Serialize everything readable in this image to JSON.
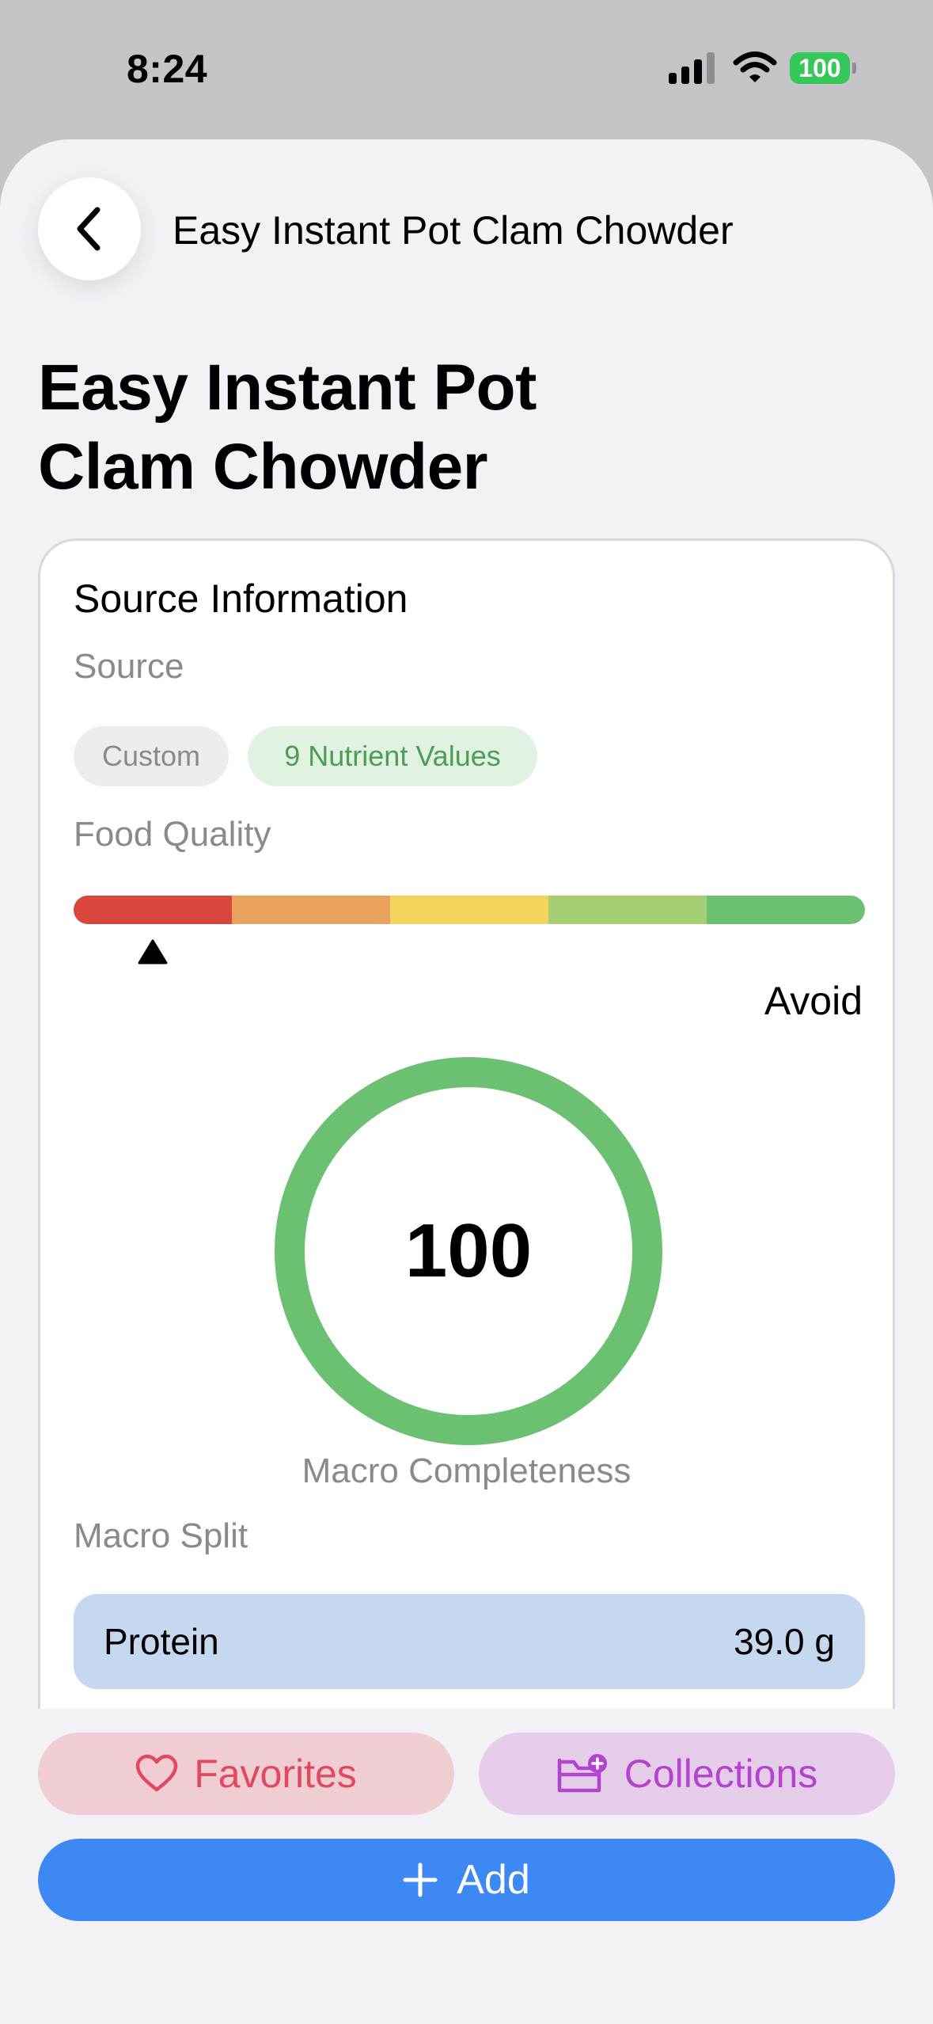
{
  "status": {
    "time": "8:24",
    "battery": "100"
  },
  "nav": {
    "title": "Easy Instant Pot Clam Chowder",
    "back_icon": "chevron-left-icon"
  },
  "page_title": "Easy Instant Pot\nClam Chowder",
  "source_card": {
    "heading": "Source Information",
    "source_label": "Source",
    "chips": {
      "custom": "Custom",
      "nutrients": "9 Nutrient Values"
    },
    "food_quality_label": "Food Quality",
    "quality_colors": [
      "#d9463e",
      "#e9a25b",
      "#f2d55a",
      "#a4cf72",
      "#6cc072"
    ],
    "quality_level": 0.1,
    "quality_result": "Avoid",
    "macro_completeness": {
      "value": "100",
      "fraction": 1.0,
      "caption": "Macro Completeness",
      "color": "#6cc072"
    },
    "macro_split_label": "Macro Split",
    "macros": [
      {
        "name": "Protein",
        "amount": "39.0 g",
        "color": "#c5d8ef"
      }
    ]
  },
  "actions": {
    "favorites": "Favorites",
    "favorites_icon": "heart-icon",
    "collections": "Collections",
    "collections_icon": "folder-plus-icon",
    "add": "Add",
    "add_icon": "plus-icon",
    "accent": "#3d88f3"
  }
}
